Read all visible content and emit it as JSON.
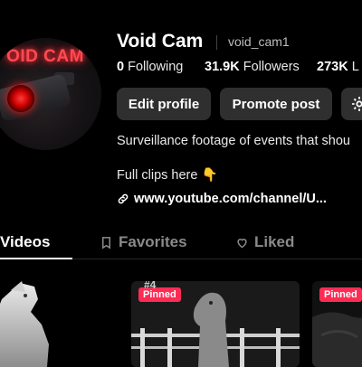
{
  "profile": {
    "avatar_text": "OID CAM",
    "display_name": "Void Cam",
    "username": "void_cam1"
  },
  "stats": {
    "following_count": "0",
    "following_label": "Following",
    "followers_count": "31.9K",
    "followers_label": "Followers",
    "likes_count": "273K",
    "likes_label": "L"
  },
  "buttons": {
    "edit_profile": "Edit profile",
    "promote_post": "Promote post"
  },
  "bio": {
    "line1": "Surveillance footage of events that shou",
    "line2": "Full clips here 👇",
    "link": "www.youtube.com/channel/U..."
  },
  "tabs": [
    {
      "label": "Videos",
      "icon": "none",
      "active": true
    },
    {
      "label": "Favorites",
      "icon": "bookmark-icon",
      "active": false
    },
    {
      "label": "Liked",
      "icon": "heart-icon",
      "active": false
    }
  ],
  "videos": [
    {
      "pinned_label": ""
    },
    {
      "pinned_label": "Pinned",
      "overlay_text": "#4"
    },
    {
      "pinned_label": "Pinned"
    }
  ],
  "colors": {
    "background": "#000000",
    "button_bg": "#2f2f2f",
    "pinned_badge": "#fe2c55",
    "inactive_tab": "#8a8a8a",
    "avatar_glow": "#ff3b3b"
  }
}
